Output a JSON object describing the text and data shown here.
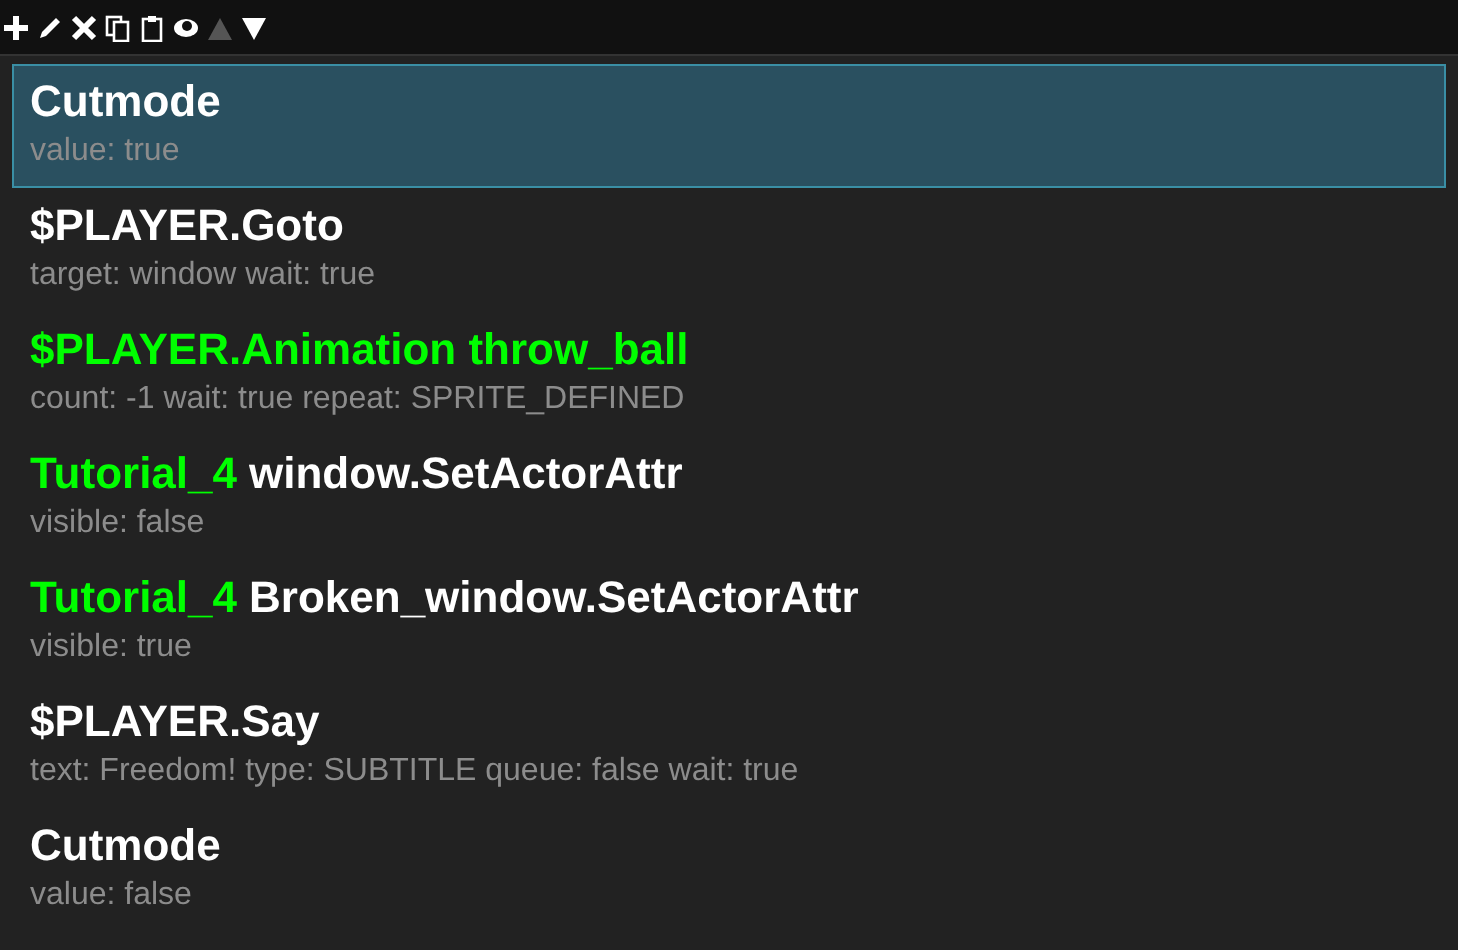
{
  "toolbar": [
    {
      "kind": "add",
      "disabled": false
    },
    {
      "kind": "edit",
      "disabled": false
    },
    {
      "kind": "delete",
      "disabled": false
    },
    {
      "kind": "copy",
      "disabled": false
    },
    {
      "kind": "paste",
      "disabled": false
    },
    {
      "kind": "view",
      "disabled": false
    },
    {
      "kind": "up",
      "disabled": true
    },
    {
      "kind": "down",
      "disabled": false
    }
  ],
  "items": [
    {
      "selected": true,
      "title": [
        {
          "text": "Cutmode",
          "color": "#ffffff"
        }
      ],
      "detail": "value: true"
    },
    {
      "selected": false,
      "title": [
        {
          "text": "$PLAYER.Goto",
          "color": "#ffffff"
        }
      ],
      "detail": "target: window wait: true"
    },
    {
      "selected": false,
      "title": [
        {
          "text": "$PLAYER.Animation throw_ball",
          "color": "#00ff00"
        }
      ],
      "detail": "count: -1 wait: true repeat: SPRITE_DEFINED"
    },
    {
      "selected": false,
      "title": [
        {
          "text": "Tutorial_4",
          "color": "#00ff00"
        },
        {
          "text": "window.SetActorAttr",
          "color": "#ffffff"
        }
      ],
      "detail": "visible: false"
    },
    {
      "selected": false,
      "title": [
        {
          "text": "Tutorial_4",
          "color": "#00ff00"
        },
        {
          "text": "Broken_window.SetActorAttr",
          "color": "#ffffff"
        }
      ],
      "detail": "visible: true"
    },
    {
      "selected": false,
      "title": [
        {
          "text": "$PLAYER.Say",
          "color": "#ffffff"
        }
      ],
      "detail": "text: Freedom! type: SUBTITLE queue: false wait: true"
    },
    {
      "selected": false,
      "title": [
        {
          "text": "Cutmode",
          "color": "#ffffff"
        }
      ],
      "detail": "value: false"
    }
  ]
}
